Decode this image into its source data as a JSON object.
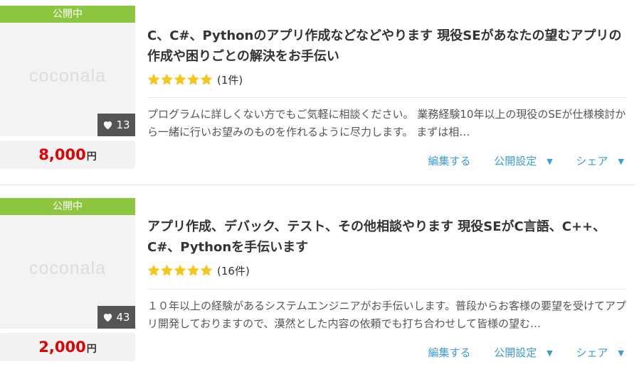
{
  "listings": [
    {
      "status": "公開中",
      "thumbnail_logo": "coconala",
      "favorites": "13",
      "price": "8,000",
      "currency": "円",
      "title": "C、C#、Pythonのアプリ作成などなどやります 現役SEがあなたの望むアプリの作成や困りごとの解決をお手伝い",
      "rating": 5,
      "review_count": "(1件)",
      "description": "プログラムに詳しくない方でもご気軽に相談ください。 業務経験10年以上の現役のSEが仕様検討から一緒に行いお望みのものを作れるように尽力します。 まずは相…",
      "actions": {
        "edit": "編集する",
        "publish_settings": "公開設定",
        "share": "シェア"
      }
    },
    {
      "status": "公開中",
      "thumbnail_logo": "coconala",
      "favorites": "43",
      "price": "2,000",
      "currency": "円",
      "title": "アプリ作成、デバック、テスト、その他相談やります 現役SEがC言語、C++、C#、Pythonを手伝います",
      "rating": 5,
      "review_count": "(16件)",
      "description": "１０年以上の経験があるシステムエンジニアがお手伝いします。普段からお客様の要望を受けてアプリ開発しておりますので、漠然とした内容の依頼でも打ち合わせして皆様の望む…",
      "actions": {
        "edit": "編集する",
        "publish_settings": "公開設定",
        "share": "シェア"
      }
    }
  ],
  "colors": {
    "status_badge": "#8cc63f",
    "price": "#e50000",
    "link": "#3d9bd6",
    "star": "#f5c518"
  }
}
